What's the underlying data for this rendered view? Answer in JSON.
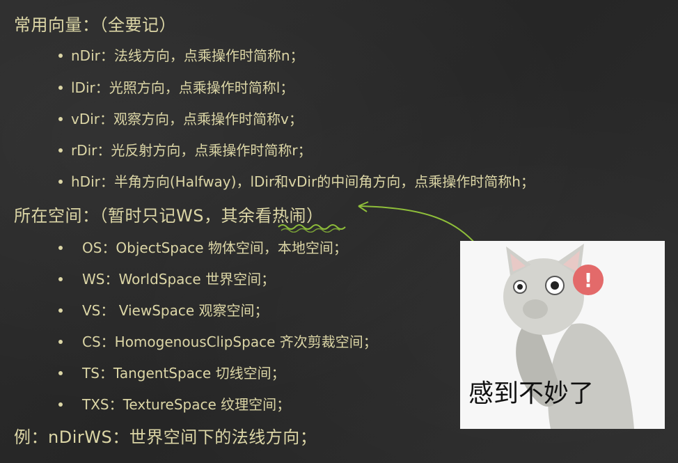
{
  "heading_vectors": "常用向量：（全要记）",
  "vectors": [
    "nDir：法线方向，点乘操作时简称n；",
    "lDir：光照方向，点乘操作时简称l；",
    "vDir：观察方向，点乘操作时简称v；",
    "rDir：光反射方向，点乘操作时简称r；",
    "hDir：半角方向(Halfway)，lDir和vDir的中间角方向，点乘操作时简称h；"
  ],
  "heading_spaces": "所在空间：（暂时只记WS，其余看热闹）",
  "spaces": [
    "OS：ObjectSpace 物体空间，本地空间；",
    "WS：WorldSpace 世界空间；",
    "VS： ViewSpace 观察空间；",
    "CS：HomogenousClipSpace 齐次剪裁空间；",
    "TS：TangentSpace 切线空间；",
    "TXS：TextureSpace 纹理空间；"
  ],
  "example": "例：nDirWS：世界空间下的法线方向；",
  "meme": {
    "caption": "感到不妙了",
    "alert_symbol": "!"
  },
  "colors": {
    "chalk_text": "#dcd6a6",
    "chalk_green": "#8fbf3a",
    "background": "#2a2a2a",
    "alert_red": "#e36a6a"
  }
}
